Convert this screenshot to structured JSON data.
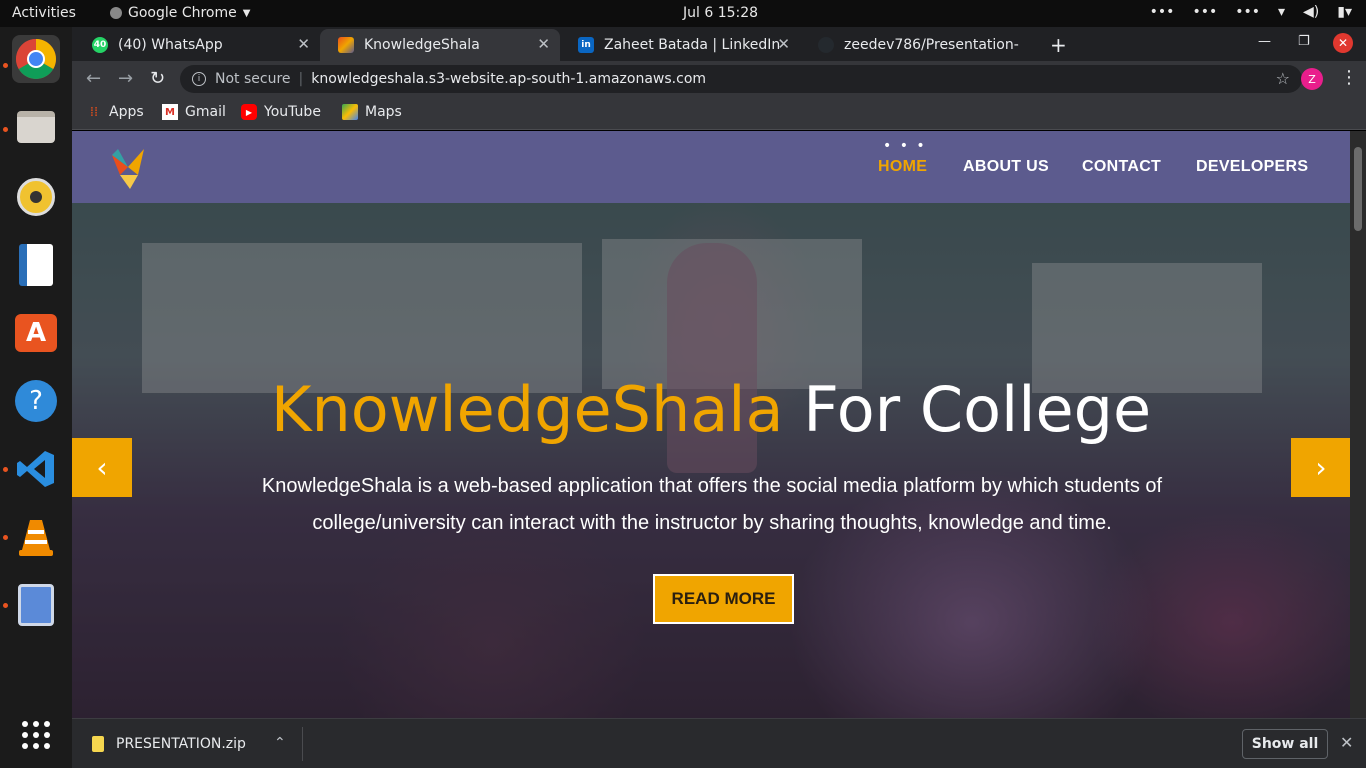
{
  "topbar": {
    "activities": "Activities",
    "app_name": "Google Chrome",
    "clock": "Jul 6  15:28"
  },
  "tabs": [
    {
      "title": "(40) WhatsApp",
      "badge": "40"
    },
    {
      "title": "KnowledgeShala"
    },
    {
      "title": "Zaheet Batada | LinkedIn",
      "badge": "in"
    },
    {
      "title": "zeedev786/Presentation-"
    }
  ],
  "omnibox": {
    "security": "Not secure",
    "url": "knowledgeshala.s3-website.ap-south-1.amazonaws.com"
  },
  "profile_initial": "Z",
  "bookmarks": [
    {
      "label": "Apps",
      "icon": "apps-grid-icon"
    },
    {
      "label": "Gmail",
      "icon": "gmail-icon"
    },
    {
      "label": "YouTube",
      "icon": "youtube-icon"
    },
    {
      "label": "Maps",
      "icon": "maps-icon"
    }
  ],
  "site": {
    "nav": [
      {
        "label": "HOME",
        "active": true
      },
      {
        "label": "ABOUT US"
      },
      {
        "label": "CONTACT"
      },
      {
        "label": "DEVELOPERS"
      }
    ],
    "hero": {
      "title_highlight": "KnowledgeShala",
      "title_rest": "For College",
      "subtitle_line1": "KnowledgeShala is a web-based application that offers the social media platform by which students of",
      "subtitle_line2": "college/university can interact with the instructor by sharing thoughts, knowledge and time.",
      "cta": "READ MORE"
    },
    "colors": {
      "accent": "#f0a500",
      "navbar": "#5c5b8e"
    }
  },
  "download_shelf": {
    "file": "PRESENTATION.zip",
    "show_all": "Show all"
  }
}
